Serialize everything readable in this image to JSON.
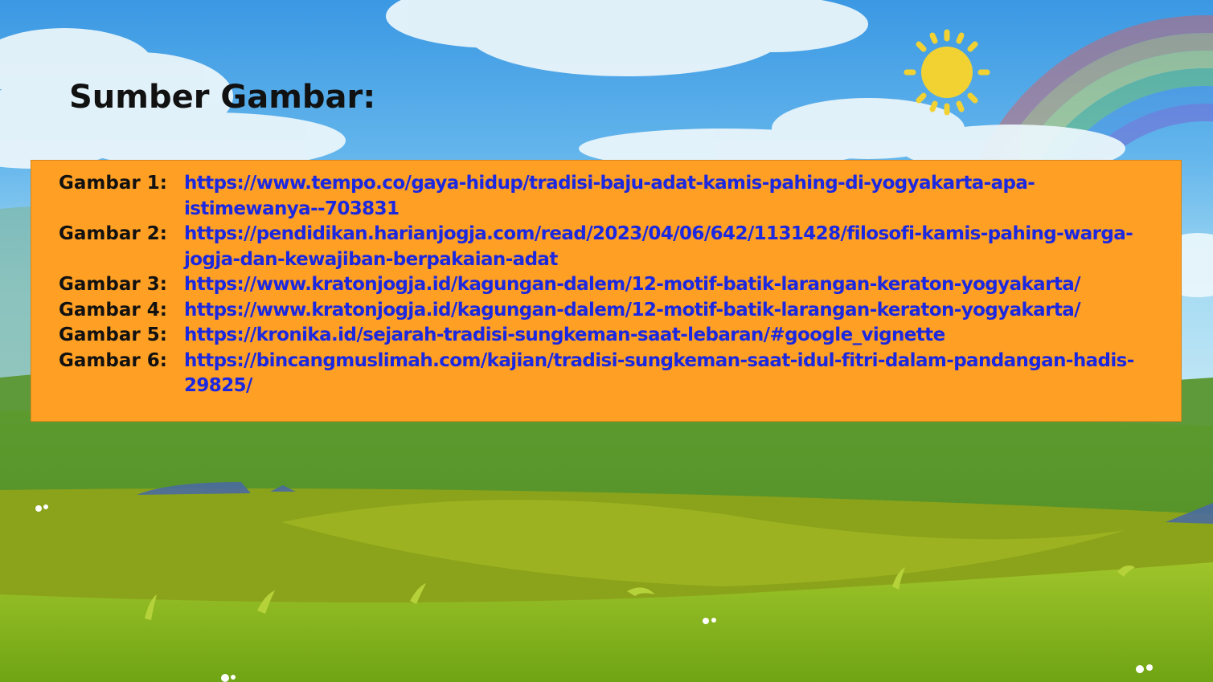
{
  "slide": {
    "title": "Sumber Gambar:",
    "sources": [
      {
        "label": "Gambar 1:",
        "url": "https://www.tempo.co/gaya-hidup/tradisi-baju-adat-kamis-pahing-di-yogyakarta-apa-istimewanya--703831"
      },
      {
        "label": "Gambar 2:",
        "url": "https://pendidikan.harianjogja.com/read/2023/04/06/642/1131428/filosofi-kamis-pahing-warga-jogja-dan-kewajiban-berpakaian-adat"
      },
      {
        "label": "Gambar 3:",
        "url": "https://www.kratonjogja.id/kagungan-dalem/12-motif-batik-larangan-keraton-yogyakarta/"
      },
      {
        "label": "Gambar 4:",
        "url": "https://www.kratonjogja.id/kagungan-dalem/12-motif-batik-larangan-keraton-yogyakarta/"
      },
      {
        "label": "Gambar 5:",
        "url": "https://kronika.id/sejarah-tradisi-sungkeman-saat-lebaran/#google_vignette"
      },
      {
        "label": "Gambar 6:",
        "url": "https://bincangmuslimah.com/kajian/tradisi-sungkeman-saat-idul-fitri-dalam-pandangan-hadis-29825/"
      }
    ]
  },
  "colors": {
    "sky_top": "#3f9ee6",
    "sky_bottom": "#aee0f4",
    "grass": "#7fb21f",
    "box_fill": "#ffa024",
    "link": "#1b28e0",
    "sun": "#f2d233"
  },
  "icons": [
    "sun-icon",
    "rainbow-icon",
    "cloud-icon",
    "flower-icon"
  ]
}
